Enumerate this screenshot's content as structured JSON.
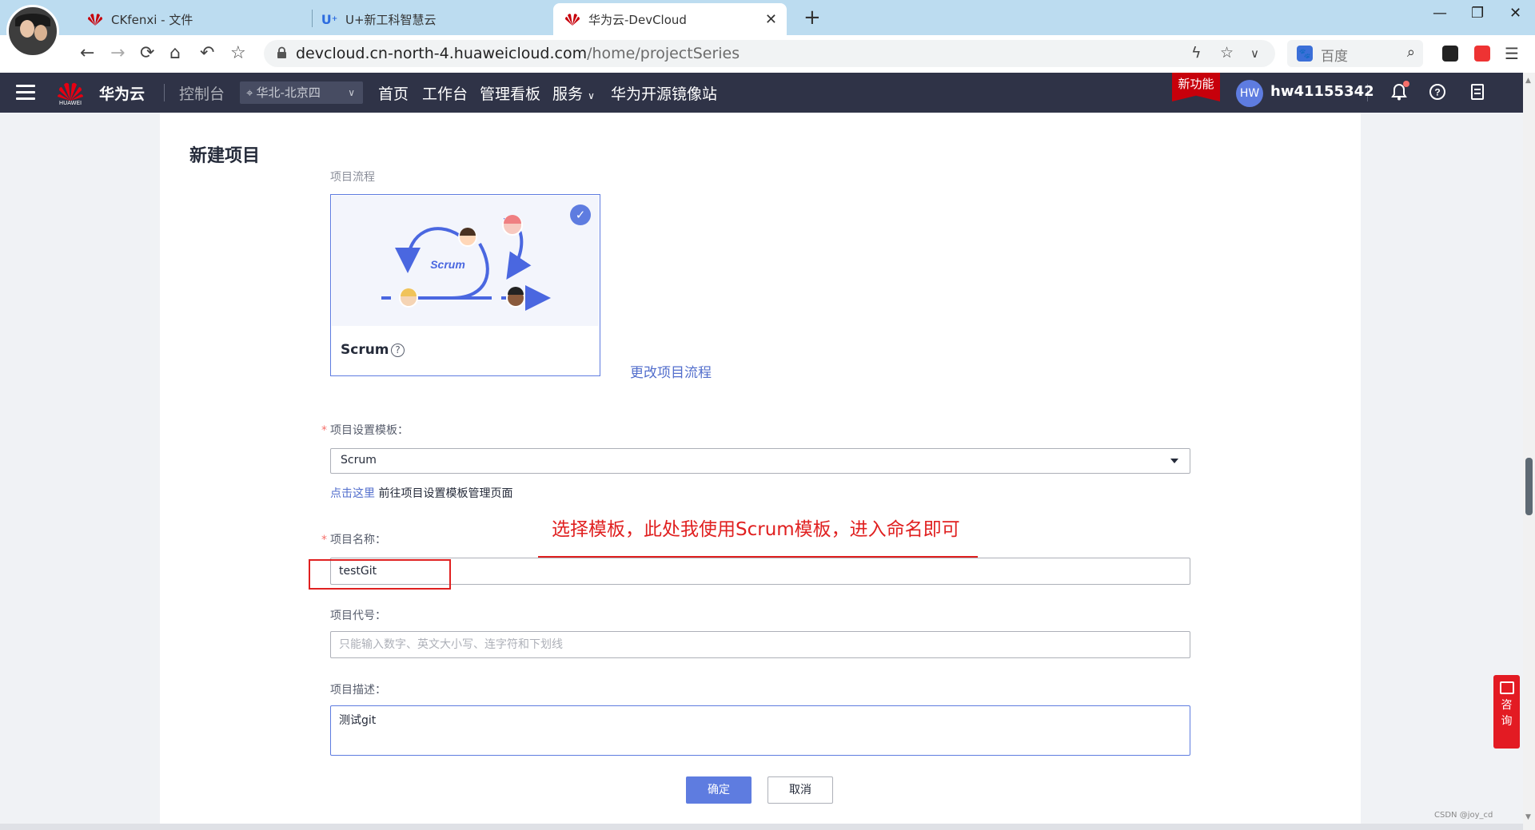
{
  "browser": {
    "tabs": [
      {
        "label": "CKfenxi - 文件",
        "icon": "huawei-icon"
      },
      {
        "label": "U+新工科智慧云",
        "icon": "u-plus-icon"
      },
      {
        "label": "华为云-DevCloud",
        "icon": "huawei-icon",
        "active": true
      }
    ],
    "url_main": "devcloud.cn-north-4.huaweicloud.com",
    "url_path": "/home/projectSeries",
    "search_engine": "百度"
  },
  "header": {
    "logo_text": "HUAWEI",
    "brand": "华为云",
    "console": "控制台",
    "region": "华北-北京四",
    "nav": [
      "首页",
      "工作台",
      "管理看板",
      "服务",
      "华为开源镜像站"
    ],
    "new_feature": "新功能",
    "avatar_initials": "HW",
    "username": "hw41155342"
  },
  "form": {
    "title": "新建项目",
    "flow_label": "项目流程",
    "flow_name": "Scrum",
    "illustration_text": "Scrum",
    "change_flow_link": "更改项目流程",
    "template_label": "项目设置模板：",
    "template_value": "Scrum",
    "hint_link": "点击这里",
    "hint_text": " 前往项目设置模板管理页面",
    "name_label": "项目名称：",
    "name_value": "testGit",
    "code_label": "项目代号：",
    "code_placeholder": "只能输入数字、英文大小写、连字符和下划线",
    "desc_label": "项目描述：",
    "desc_value": "测试git",
    "ok_button": "确定",
    "cancel_button": "取消"
  },
  "annotation": "选择模板，此处我使用Scrum模板，进入命名即可",
  "consult": [
    "咨",
    "询"
  ],
  "watermark": "CSDN @joy_cd",
  "colors": {
    "header_bg": "#2f3347",
    "primary": "#5e7ce0",
    "huawei_red": "#c7000b",
    "annotation_red": "#e02020",
    "tab_bar": "#bcdcf0"
  }
}
